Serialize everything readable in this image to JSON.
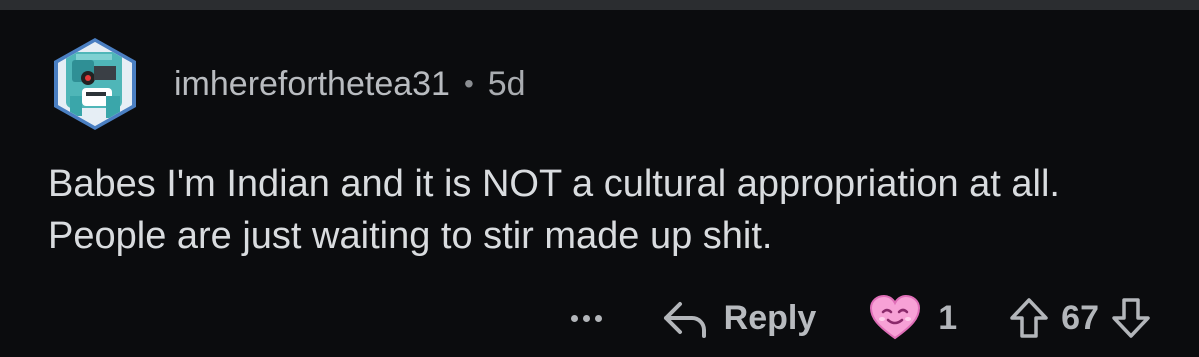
{
  "comment": {
    "username": "imhereforthetea31",
    "separator": "•",
    "age": "5d",
    "text": "Babes I'm Indian and it is NOT a cultural appropriation at all. People are just waiting to stir made up shit."
  },
  "actions": {
    "more_icon": "ellipsis-icon",
    "reply_icon": "reply-arrow-icon",
    "reply_label": "Reply",
    "award_icon": "heart-face-award-icon",
    "award_count": "1",
    "upvote_icon": "upvote-arrow-icon",
    "score": "67",
    "downvote_icon": "downvote-arrow-icon"
  },
  "colors": {
    "background": "#0b0c0e",
    "text": "#d9dcdf",
    "muted": "#a9acb0",
    "award_pink": "#f7a1d6"
  }
}
